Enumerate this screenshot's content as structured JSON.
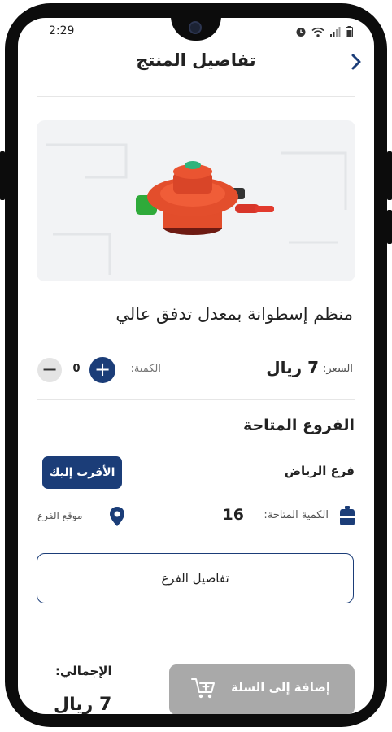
{
  "status_bar": {
    "time": "2:29"
  },
  "header": {
    "title": "تفاصيل المنتج",
    "back_icon": "chevron-right-icon"
  },
  "product": {
    "name": "منظم إسطوانة بمعدل تدفق عالي",
    "price_label": "السعر:",
    "price_value": "7 ريال",
    "quantity_label": "الكمية:",
    "quantity_value": "0"
  },
  "branches": {
    "title": "الفروع المتاحة",
    "items": [
      {
        "name": "فرع الرياض",
        "nearest_badge": "الأقرب إليك",
        "available_label": "الكمية المتاحة:",
        "available_value": "16",
        "location_label": "موقع الفرع"
      }
    ],
    "details_button": "تفاصيل الفرع"
  },
  "footer": {
    "total_label": "الإجمالي:",
    "total_value": "7 ريال",
    "add_to_cart": "إضافة إلى السلة"
  },
  "colors": {
    "primary": "#1b3d78",
    "disabled": "#a9a9a9",
    "image_bg": "#f2f3f5"
  }
}
